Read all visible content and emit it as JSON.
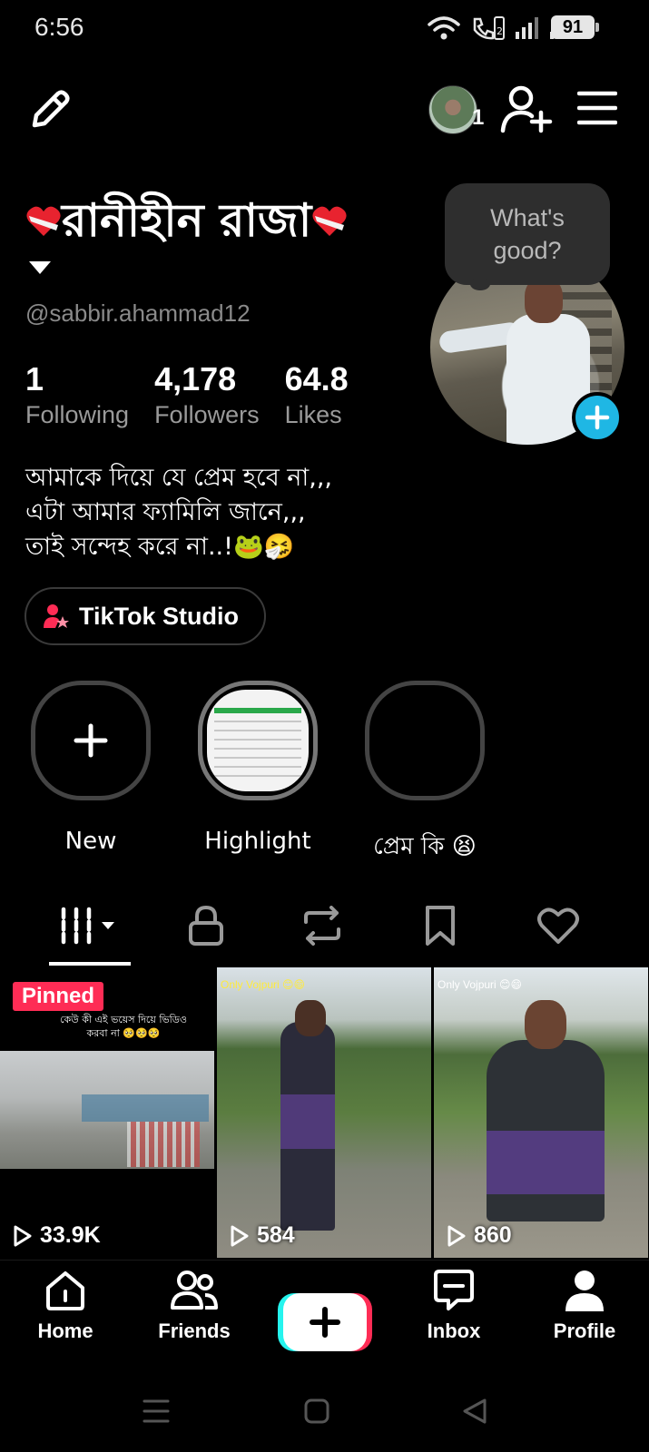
{
  "status_bar": {
    "time": "6:56",
    "battery": "91",
    "icons": [
      "wifi-icon",
      "volte-call-icon",
      "signal-1-icon",
      "signal-2-icon"
    ]
  },
  "header": {
    "edit_icon": "pencil-icon",
    "account_switch_count": "1",
    "add_friend_icon": "person-plus-icon",
    "menu_icon": "hamburger-icon"
  },
  "profile": {
    "display_name": "রানীহীন রাজা",
    "username": "@sabbir.ahammad12",
    "bubble_text": "What's good?",
    "stats": [
      {
        "value": "1",
        "label": "Following"
      },
      {
        "value": "4,178",
        "label": "Followers"
      },
      {
        "value": "64.8",
        "label": "Likes"
      }
    ],
    "bio_lines": [
      "আমাকে দিয়ে যে প্রেম হবে না,,,",
      "এটা আমার ফ্যামিলি জানে,,,",
      "তাই সন্দেহ করে না..!🐸🤧"
    ],
    "studio_button": "TikTok Studio"
  },
  "highlights": [
    {
      "label": "New"
    },
    {
      "label": "Highlight"
    },
    {
      "label": "প্রেম কি 😫"
    }
  ],
  "tabs": [
    {
      "icon": "grid-icon",
      "active": true
    },
    {
      "icon": "lock-icon",
      "active": false
    },
    {
      "icon": "repost-icon",
      "active": false
    },
    {
      "icon": "bookmark-icon",
      "active": false
    },
    {
      "icon": "heart-icon",
      "active": false
    }
  ],
  "videos": [
    {
      "badge": "Pinned",
      "caption": "কেউ কী এই ভয়েস দিয়ে ভিডিও করবা না 🥺🥺🥺",
      "views": "33.9K"
    },
    {
      "caption": "Only Vojpuri 😊😄",
      "views": "584"
    },
    {
      "caption": "Only Vojpuri 😊😄",
      "views": "860"
    }
  ],
  "bottom_nav": {
    "home": "Home",
    "friends": "Friends",
    "inbox": "Inbox",
    "profile": "Profile"
  },
  "colors": {
    "accent_red": "#fe2c55",
    "accent_cyan": "#1fb7e4",
    "background": "#000000"
  }
}
